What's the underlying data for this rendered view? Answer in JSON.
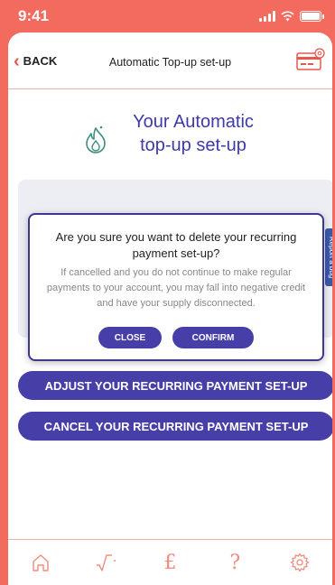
{
  "status_bar": {
    "time": "9:41"
  },
  "nav": {
    "back_label": "BACK",
    "title": "Automatic Top-up set-up",
    "card_icon": "payment-card-settings-icon"
  },
  "hero": {
    "icon": "flame-icon",
    "title_line1": "Your Automatic",
    "title_line2": "top-up set-up"
  },
  "report_tab": {
    "label": "Report a bug"
  },
  "dialog": {
    "title": "Are you sure you want to delete your recurring payment set-up?",
    "body": "If cancelled and you do not continue to make regular payments to your account, you may fall into negative credit and have your supply disconnected.",
    "close_label": "CLOSE",
    "confirm_label": "CONFIRM"
  },
  "actions": {
    "adjust_label": "ADJUST YOUR RECURRING PAYMENT SET-UP",
    "cancel_label": "CANCEL YOUR RECURRING PAYMENT SET-UP"
  },
  "tabbar": {
    "items": [
      {
        "icon": "home-icon"
      },
      {
        "icon": "usage-graph-icon"
      },
      {
        "icon": "pound-icon",
        "glyph": "£"
      },
      {
        "icon": "help-icon",
        "glyph": "?"
      },
      {
        "icon": "settings-icon"
      }
    ]
  },
  "colors": {
    "brand_coral": "#f26b5e",
    "primary_purple": "#463fa8",
    "title_purple": "#3e3aa8"
  }
}
